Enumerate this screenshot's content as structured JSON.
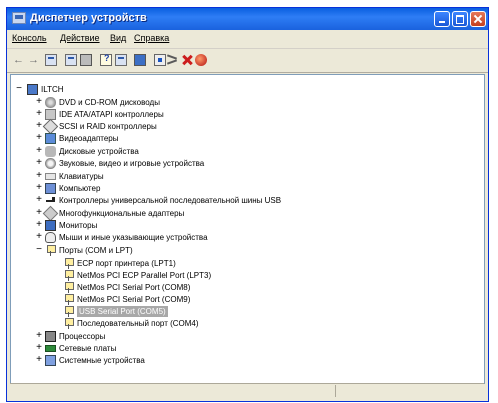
{
  "window": {
    "title": "Диспетчер устройств"
  },
  "menu": [
    "Консоль",
    "Действие",
    "Вид",
    "Справка"
  ],
  "toolbar": [
    "back-arrow-icon",
    "forward-arrow-icon",
    "properties-icon",
    "properties2-icon",
    "print-icon",
    "help-icon",
    "show-hidden-icon",
    "monitor-icon",
    "scan-hardware-icon",
    "update-driver-icon",
    "uninstall-icon",
    "disable-icon"
  ],
  "tree": {
    "root": "ILTCH",
    "categories": [
      "DVD и CD-ROM дисководы",
      "IDE ATA/ATAPI контроллеры",
      "SCSI и RAID контроллеры",
      "Видеоадаптеры",
      "Дисковые устройства",
      "Звуковые, видео и игровые устройства",
      "Клавиатуры",
      "Компьютер",
      "Контроллеры универсальной последовательной шины USB",
      "Многофункциональные адаптеры",
      "Мониторы",
      "Мыши и иные указывающие устройства",
      "Порты (COM и LPT)"
    ],
    "ports": [
      "ECP порт принтера (LPT1)",
      "NetMos PCI ECP Parallel Port (LPT3)",
      "NetMos PCI Serial Port (COM8)",
      "NetMos PCI Serial Port (COM9)",
      "USB Serial Port (COM5)",
      "Последовательный порт (COM4)"
    ],
    "after": [
      "Процессоры",
      "Сетевые платы",
      "Системные устройства"
    ]
  }
}
